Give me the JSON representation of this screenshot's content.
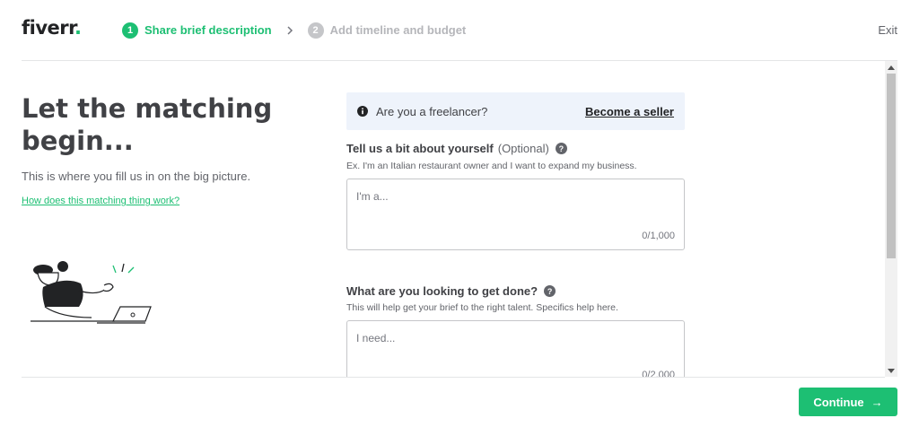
{
  "header": {
    "logo_text": "fiverr",
    "logo_dot": ".",
    "steps": [
      {
        "number": "1",
        "label": "Share brief description",
        "state": "active"
      },
      {
        "number": "2",
        "label": "Add timeline and budget",
        "state": "inactive"
      }
    ],
    "exit_label": "Exit"
  },
  "hero": {
    "title": "Let the matching begin...",
    "subtitle": "This is where you fill us in on the big picture.",
    "link": "How does this matching thing work?"
  },
  "banner": {
    "text": "Are you a freelancer?",
    "link": "Become a seller"
  },
  "fields": [
    {
      "label": "Tell us a bit about yourself",
      "optional": "(Optional)",
      "hint": "Ex. I'm an Italian restaurant owner and I want to expand my business.",
      "placeholder": "I'm a...",
      "counter": "0/1,000"
    },
    {
      "label": "What are you looking to get done?",
      "hint": "This will help get your brief to the right talent. Specifics help here.",
      "placeholder": "I need...",
      "counter": "0/2,000"
    }
  ],
  "footer": {
    "continue_label": "Continue",
    "continue_arrow": "→"
  },
  "colors": {
    "brand_green": "#1dbf73",
    "banner_bg": "#eef3fb",
    "text_dark": "#404145"
  }
}
